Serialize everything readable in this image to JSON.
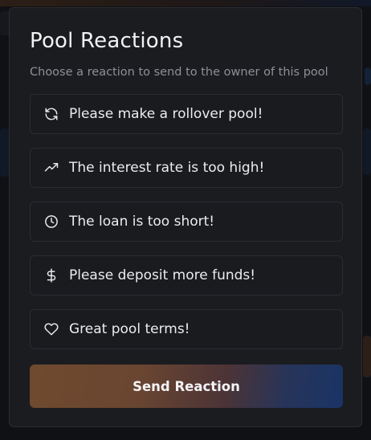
{
  "modal": {
    "title": "Pool Reactions",
    "subtitle": "Choose a reaction to send to the owner of this pool",
    "reactions": [
      {
        "label": "Please make a rollover pool!",
        "icon": "refresh-icon"
      },
      {
        "label": "The interest rate is too high!",
        "icon": "trending-up-icon"
      },
      {
        "label": "The loan is too short!",
        "icon": "clock-icon"
      },
      {
        "label": "Please deposit more funds!",
        "icon": "dollar-icon"
      },
      {
        "label": "Great pool terms!",
        "icon": "heart-icon"
      }
    ],
    "send_label": "Send Reaction"
  },
  "colors": {
    "modal_bg": "#1b1c20",
    "option_border": "#2b2c32",
    "text": "#ececee",
    "subtext": "#8d9097",
    "button_gradient_start": "#6f4a2e",
    "button_gradient_end": "#1a3466"
  }
}
